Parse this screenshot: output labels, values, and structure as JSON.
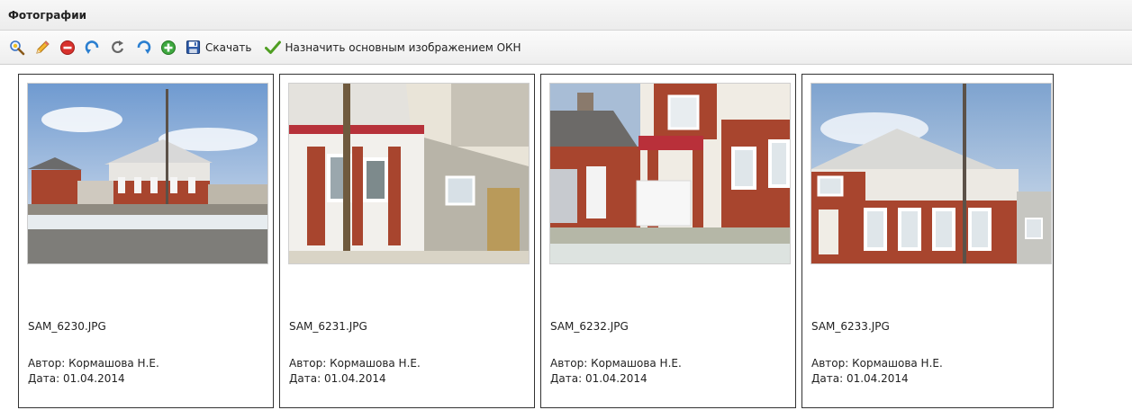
{
  "panel": {
    "title": "Фотографии"
  },
  "toolbar": {
    "icons": [
      "zoom-icon",
      "edit-icon",
      "delete-icon",
      "rotate-left-icon",
      "refresh-icon",
      "rotate-right-icon",
      "add-icon",
      "save-icon"
    ],
    "download_label": "Скачать",
    "set_main_label": "Назначить основным изображением ОКН"
  },
  "photos": [
    {
      "filename": "SAM_6230.JPG",
      "author_label": "Автор:",
      "author": "Кормашова Н.Е.",
      "date_label": "Дата:",
      "date": "01.04.2014"
    },
    {
      "filename": "SAM_6231.JPG",
      "author_label": "Автор:",
      "author": "Кормашова Н.Е.",
      "date_label": "Дата:",
      "date": "01.04.2014"
    },
    {
      "filename": "SAM_6232.JPG",
      "author_label": "Автор:",
      "author": "Кормашова Н.Е.",
      "date_label": "Дата:",
      "date": "01.04.2014"
    },
    {
      "filename": "SAM_6233.JPG",
      "author_label": "Автор:",
      "author": "Кормашова Н.Е.",
      "date_label": "Дата:",
      "date": "01.04.2014"
    }
  ],
  "colors": {
    "brick": "#a8452e",
    "sky": "#8fb0d8",
    "wall": "#e9e6df",
    "save_blue": "#2c5aa8",
    "check_green": "#4f9e22",
    "delete_red": "#d8322d",
    "rotate_blue": "#2b7fd0",
    "add_green": "#3ea840"
  }
}
